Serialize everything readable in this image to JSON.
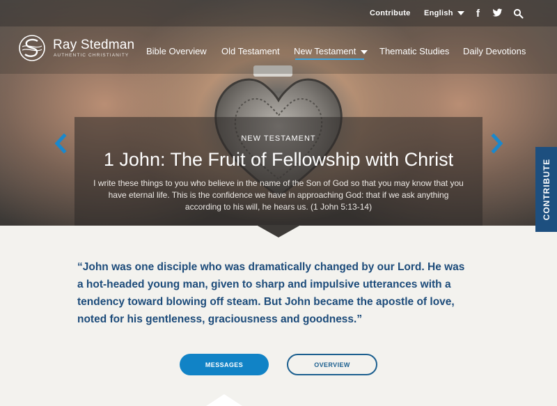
{
  "topbar": {
    "contribute": "Contribute",
    "language": "English",
    "icons": [
      "facebook-icon",
      "twitter-icon",
      "search-icon"
    ]
  },
  "brand": {
    "name": "Ray Stedman",
    "tagline": "AUTHENTIC CHRISTIANITY"
  },
  "nav": {
    "items": [
      {
        "label": "Bible Overview"
      },
      {
        "label": "Old Testament"
      },
      {
        "label": "New Testament",
        "active": true
      },
      {
        "label": "Thematic Studies"
      },
      {
        "label": "Daily Devotions"
      }
    ]
  },
  "hero": {
    "kicker": "NEW TESTAMENT",
    "title": "1 John: The Fruit of Fellowship with Christ",
    "verse": "I write these things to you who believe in the name of the Son of God so that you may know that you have eternal life. This is the confidence we have in approaching God: that if we ask anything according to his will, he hears us. (1 John 5:13-14)"
  },
  "side_tab": {
    "label": "CONTRIBUTE"
  },
  "quote": {
    "text": "“John was one disciple who was dramatically changed by our Lord. He was a hot-headed young man, given to sharp and impulsive utterances with a tendency toward blowing off steam. But John became the apostle of love, noted for his gentleness, graciousness and goodness.”"
  },
  "buttons": {
    "messages": "MESSAGES",
    "overview": "OVERVIEW"
  },
  "colors": {
    "accent": "#1183c6",
    "navy": "#1c4b7a",
    "tab": "#1d4f7f",
    "underline": "#3aa6e0"
  }
}
